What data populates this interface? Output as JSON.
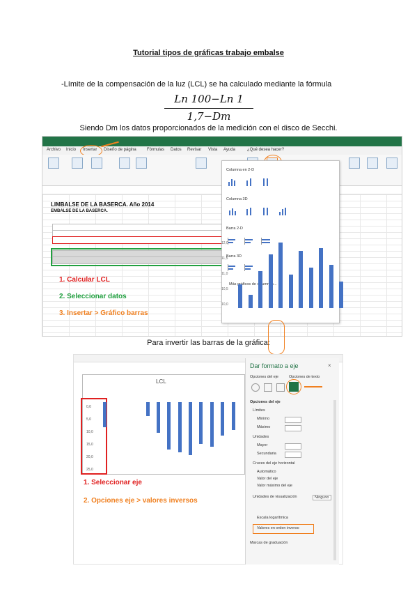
{
  "document": {
    "title": "Tutorial tipos de gráficas trabajo embalse",
    "paragraph1": "-Límite de la compensación de la luz (LCL) se ha calculado mediante la fórmula",
    "formula_numerator": "Ln 100−Ln 1",
    "formula_denominator": "1,7−Dm",
    "paragraph2": "Siendo Dm los datos proporcionados de la medición con el disco de Secchi.",
    "paragraph3": "Para invertir las barras de la gráfica:"
  },
  "screenshot1": {
    "tabs": [
      "Archivo",
      "Inicio",
      "Insertar",
      "Diseño de página",
      "Fórmulas",
      "Datos",
      "Revisar",
      "Vista",
      "Ayuda",
      "¿Qué desea hacer?"
    ],
    "sheet_title": "LIMBALSE DE LA BASERCA. Año 2014",
    "sheet_subtitle": "EMBALSE DE LA BASERCA.",
    "dropdown": {
      "section1": "Columna en 2-D",
      "section2": "Columna 3D",
      "section3": "Barra 2-D",
      "section4": "Barra 3D",
      "more": "Más gráficos de columnas..."
    },
    "chart_axis": [
      "12,0",
      "11,5",
      "11,0",
      "10,5",
      "10,0"
    ],
    "chart_bar_levels": [
      0.35,
      0.2,
      0.55,
      0.8,
      0.98,
      0.5,
      0.85,
      0.6,
      0.9,
      0.65,
      0.4
    ],
    "steps": [
      {
        "text": "1. Calcular LCL",
        "color": "#e02020"
      },
      {
        "text": "2. Seleccionar datos",
        "color": "#22a040"
      },
      {
        "text": "3. Insertar > Gráfico barras",
        "color": "#f08020"
      }
    ]
  },
  "screenshot2": {
    "chart_title": "LCL",
    "axis_labels": [
      "0,0",
      "5,0",
      "10,0",
      "15,0",
      "20,0",
      "25,0"
    ],
    "bar_levels": [
      0.45,
      0.0,
      0.0,
      0.0,
      0.25,
      0.55,
      0.85,
      0.9,
      0.95,
      0.75,
      0.8,
      0.6,
      0.5
    ],
    "panel_title": "Dar formato a eje",
    "panel_tabs": [
      "Opciones del eje",
      "Opciones de texto"
    ],
    "panel_section": "Opciones del eje",
    "panel_rows": [
      "Límites",
      "Mínimo",
      "Máximo",
      "Unidades",
      "Mayor",
      "Secundaria",
      "Cruces del eje horizontal",
      "Automático",
      "Valor del eje",
      "Valor máximo del eje",
      "Unidades de visualización",
      "Ninguno",
      "Escala logarítmica",
      "Valores en orden inverso",
      "Marcas de graduación"
    ],
    "steps": [
      {
        "text": "1. Seleccionar eje",
        "color": "#e02020"
      },
      {
        "text": "2. Opciones eje > valores inversos",
        "color": "#f08020"
      }
    ]
  }
}
